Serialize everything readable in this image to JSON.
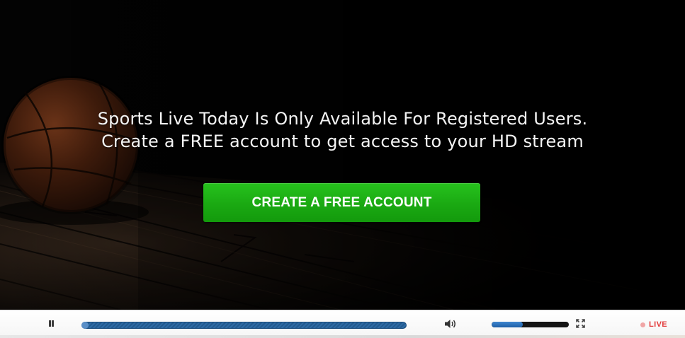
{
  "overlay": {
    "message_line1": "Sports Live Today Is Only Available For Registered Users.",
    "message_line2": "Create a FREE account to get access to your HD stream",
    "cta_label": "CREATE A FREE ACCOUNT"
  },
  "controls": {
    "play_state": "pause-icon",
    "volume_icon": "speaker-icon",
    "volume_level": 0.4,
    "fullscreen_icon": "fullscreen-icon",
    "live_label": "LIVE"
  },
  "colors": {
    "cta_green": "#1fb316",
    "seek_blue": "#2d6aa4",
    "live_red": "#e23b3b"
  }
}
